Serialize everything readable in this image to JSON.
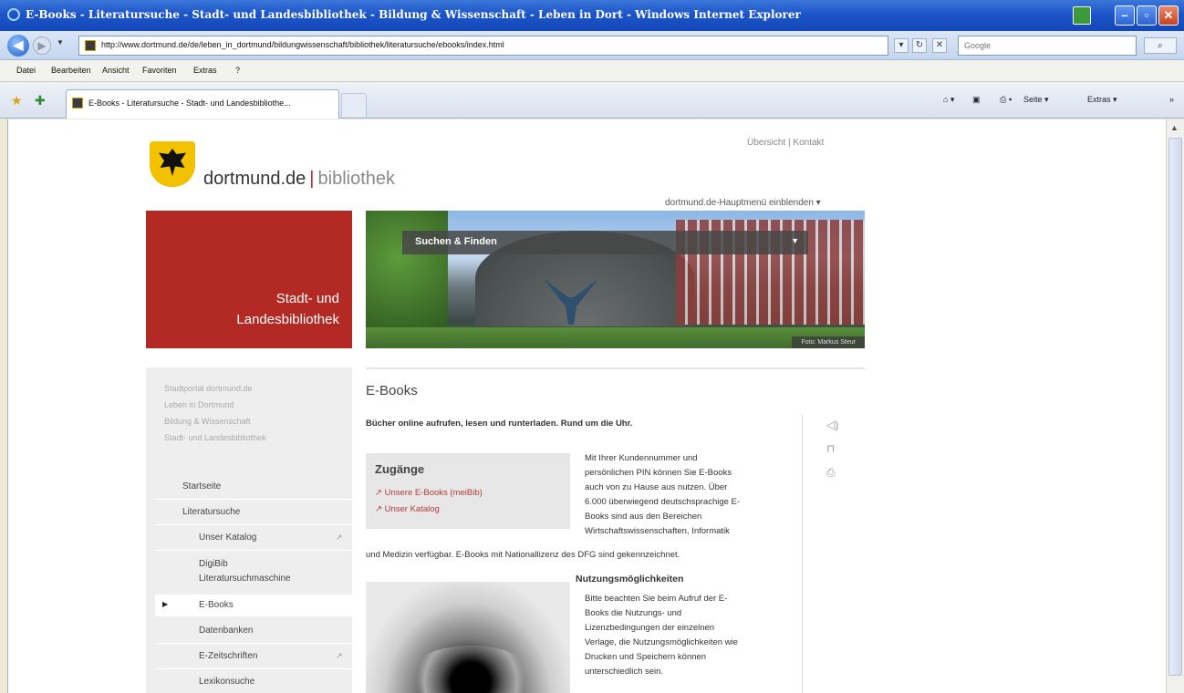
{
  "window": {
    "title": "E-Books - Literatursuche - Stadt- und Landesbibliothek - Bildung & Wissenschaft - Leben in Dort - Windows Internet Explorer",
    "minimize": "–",
    "maximize": "▫",
    "close": "✕"
  },
  "address": {
    "url": "http://www.dortmund.de/de/leben_in_dortmund/bildungwissenschaft/bibliothek/literatursuche/ebooks/index.html",
    "search_placeholder": "Google",
    "refresh": "↻",
    "stop": "✕",
    "search_button": "⌕"
  },
  "menu": [
    "Datei",
    "Bearbeiten",
    "Ansicht",
    "Favoriten",
    "Extras",
    "?"
  ],
  "tabs": {
    "active_label": "E-Books - Literatursuche - Stadt- und Landesbibliothe...",
    "commands": {
      "page": "Seite ▾",
      "extras": "Extras ▾",
      "more": "»"
    }
  },
  "site": {
    "brand_main": "dortmund.de",
    "brand_sep": "|",
    "brand_sub": "bibliothek",
    "top_links": [
      "Übersicht",
      "|",
      "Kontakt"
    ],
    "main_menu_toggle": "dortmund.de-Hauptmenü einblenden ▾",
    "red_box_line1": "Stadt- und",
    "red_box_line2": "Landesbibliothek",
    "hero_dropdown": "Suchen & Finden",
    "hero_credit": "Foto: Markus Steur"
  },
  "leftnav": {
    "breadcrumb": [
      "Stadtportal dortmund.de",
      "Leben in Dortmund",
      "Bildung & Wissenschaft",
      "Stadt- und Landesbibliothek"
    ],
    "items": [
      {
        "label": "Startseite"
      },
      {
        "label": "Literatursuche"
      },
      {
        "label": "Unser Katalog",
        "external": true
      },
      {
        "label": "DigiBib",
        "label2": "Literatursuchmaschine"
      },
      {
        "label": "E-Books",
        "active": true
      },
      {
        "label": "Datenbanken"
      },
      {
        "label": "E-Zeitschriften",
        "external": true
      },
      {
        "label": "Lexikonsuche"
      }
    ]
  },
  "content": {
    "heading": "E-Books",
    "lead": "Bücher online aufrufen, lesen und runterladen. Rund um die Uhr.",
    "zugaenge_heading": "Zugänge",
    "zugaenge_links": [
      "Unsere E-Books (meiBib)",
      "Unser Katalog"
    ],
    "para1_lines": [
      "Mit Ihrer Kundennummer und",
      "persönlichen PIN können Sie E-Books",
      "auch von zu Hause aus nutzen. Über",
      "6.000 überwiegend deutschsprachige E-",
      "Books sind aus den Bereichen",
      "Wirtschaftswissenschaften, Informatik"
    ],
    "para1_tail": "und Medizin verfügbar. E-Books mit Nationallizenz des DFG sind gekennzeichnet.",
    "section2_heading": "Nutzungsmöglichkeiten",
    "para2_lines": [
      "Bitte beachten Sie beim Aufruf der E-",
      "Books die Nutzungs- und",
      "Lizenzbedingungen der einzelnen",
      "Verlage, die Nutzungsmöglichkeiten wie",
      "Drucken und Speichern können",
      "unterschiedlich sein."
    ],
    "side_icons": [
      "speaker-icon",
      "bookmark-icon",
      "print-icon"
    ],
    "side_glyphs": [
      "◁)",
      "⊓",
      "⎙"
    ]
  },
  "icons": {
    "external": "↗",
    "active_arrow": "▶"
  }
}
